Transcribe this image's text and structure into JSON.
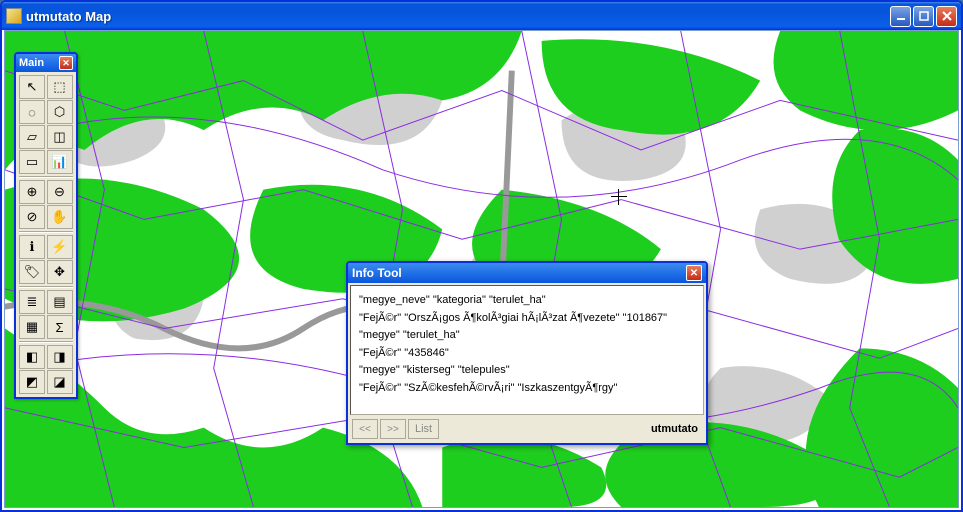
{
  "window": {
    "title": "utmutato Map"
  },
  "toolbox": {
    "title": "Main",
    "tools": [
      {
        "name": "pointer-icon",
        "glyph": "↖"
      },
      {
        "name": "marquee-icon",
        "glyph": "⬚"
      },
      {
        "name": "radius-select-icon",
        "glyph": "◌"
      },
      {
        "name": "boundary-select-icon",
        "glyph": "⬡"
      },
      {
        "name": "polygon-select-icon",
        "glyph": "▱"
      },
      {
        "name": "invert-select-icon",
        "glyph": "◫"
      },
      {
        "name": "unselect-icon",
        "glyph": "▭"
      },
      {
        "name": "graph-select-icon",
        "glyph": "📊"
      },
      {
        "name": "zoom-in-icon",
        "glyph": "⊕"
      },
      {
        "name": "zoom-out-icon",
        "glyph": "⊖"
      },
      {
        "name": "change-view-icon",
        "glyph": "⊘"
      },
      {
        "name": "pan-icon",
        "glyph": "✋"
      },
      {
        "name": "info-tool-icon",
        "glyph": "ℹ"
      },
      {
        "name": "hotlink-icon",
        "glyph": "⚡"
      },
      {
        "name": "label-icon",
        "glyph": "🏷"
      },
      {
        "name": "drag-window-icon",
        "glyph": "✥"
      },
      {
        "name": "layer-control-icon",
        "glyph": "≣"
      },
      {
        "name": "legend-icon",
        "glyph": "▤"
      },
      {
        "name": "statistics-icon",
        "glyph": "▦"
      },
      {
        "name": "sum-icon",
        "glyph": "Σ"
      },
      {
        "name": "set-target-icon",
        "glyph": "◧"
      },
      {
        "name": "clip-region-icon",
        "glyph": "◨"
      },
      {
        "name": "clip-on-icon",
        "glyph": "◩"
      },
      {
        "name": "clip-off-icon",
        "glyph": "◪"
      }
    ]
  },
  "info_tool": {
    "title": "Info Tool",
    "rows": [
      "\"megye_neve\" \"kategoria\" \"terulet_ha\"",
      "\"FejÃ©r\" \"OrszÃ¡gos Ã¶kolÃ³giai hÃ¡lÃ³zat Ã¶vezete\" \"101867\"",
      "\"megye\" \"terulet_ha\"",
      "\"FejÃ©r\" \"435846\"",
      "\"megye\" \"kisterseg\" \"telepules\"",
      "\"FejÃ©r\" \"SzÃ©kesfehÃ©rvÃ¡ri\" \"IszkaszentgyÃ¶rgy\""
    ],
    "prev_label": "<<",
    "next_label": ">>",
    "list_label": "List",
    "source_label": "utmutato"
  }
}
